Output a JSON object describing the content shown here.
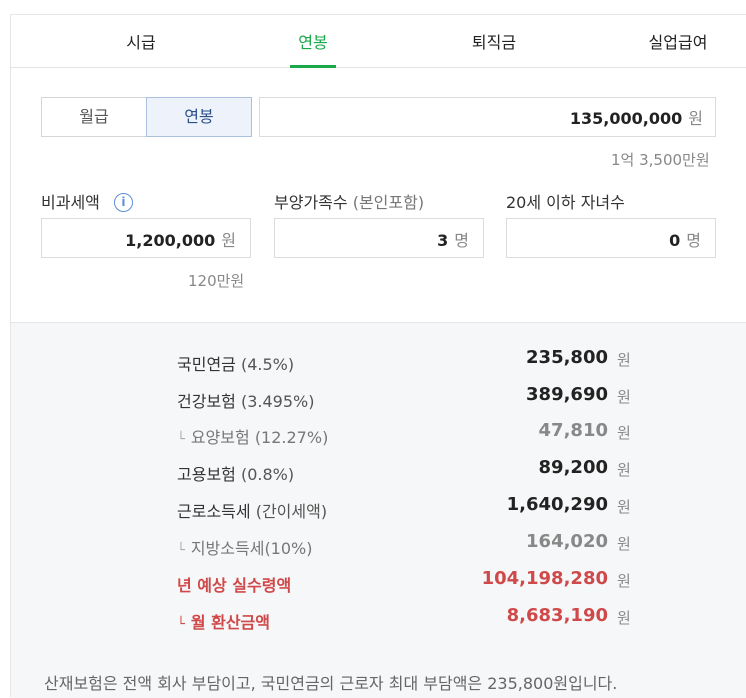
{
  "tabs": [
    "시급",
    "연봉",
    "퇴직금",
    "실업급여"
  ],
  "active_tab": "연봉",
  "pay_type": {
    "options": [
      "월급",
      "연봉"
    ],
    "selected": "연봉"
  },
  "salary": {
    "value": "135,000,000",
    "unit": "원",
    "hint": "1억 3,500만원"
  },
  "nontax": {
    "label": "비과세액",
    "info_icon": "info-icon",
    "value": "1,200,000",
    "unit": "원",
    "hint": "120만원"
  },
  "dependents": {
    "label": "부양가족수",
    "label_sub": "(본인포함)",
    "value": "3",
    "unit": "명"
  },
  "children": {
    "label": "20세 이하 자녀수",
    "value": "0",
    "unit": "명"
  },
  "results": [
    {
      "label": "국민연금",
      "sub": "(4.5%)",
      "value": "235,800",
      "unit": "원",
      "style": "normal"
    },
    {
      "label": "건강보험",
      "sub": "(3.495%)",
      "value": "389,690",
      "unit": "원",
      "style": "normal"
    },
    {
      "label": "요양보험",
      "sub": "(12.27%)",
      "value": "47,810",
      "unit": "원",
      "style": "sub"
    },
    {
      "label": "고용보험",
      "sub": "(0.8%)",
      "value": "89,200",
      "unit": "원",
      "style": "normal"
    },
    {
      "label": "근로소득세",
      "sub": "(간이세액)",
      "value": "1,640,290",
      "unit": "원",
      "style": "normal"
    },
    {
      "label": "지방소득세",
      "sub": "(10%)",
      "value": "164,020",
      "unit": "원",
      "style": "sub"
    },
    {
      "label": "년 예상 실수령액",
      "sub": "",
      "value": "104,198,280",
      "unit": "원",
      "style": "red"
    },
    {
      "label": "월 환산금액",
      "sub": "",
      "value": "8,683,190",
      "unit": "원",
      "style": "red-sub"
    }
  ],
  "note": "산재보험은 전액 회사 부담이고, 국민연금의 근로자 최대 부담액은 235,800원입니다.",
  "colors": {
    "accent": "#19a84a",
    "highlight": "#d0494a",
    "selected_seg": "#2c4f86"
  }
}
